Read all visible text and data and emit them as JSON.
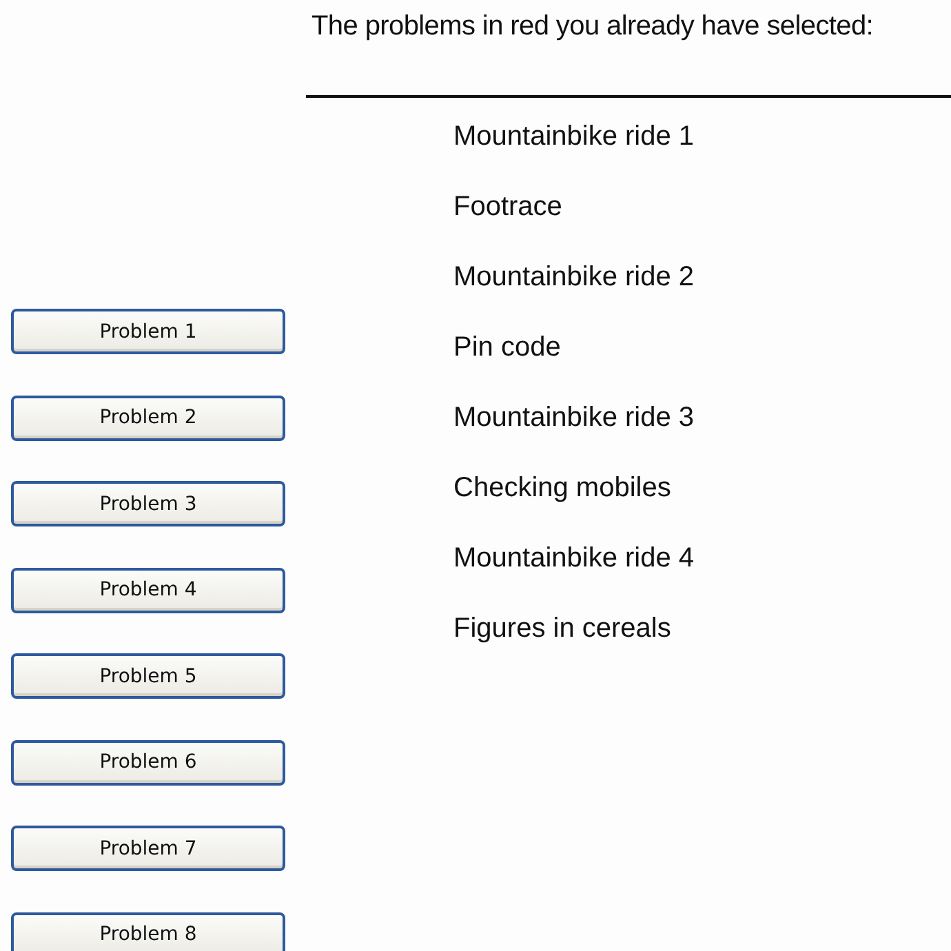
{
  "heading": "The problems in red you already have selected:",
  "buttons": [
    "Problem 1",
    "Problem 2",
    "Problem 3",
    "Problem 4",
    "Problem 5",
    "Problem 6",
    "Problem 7",
    "Problem 8"
  ],
  "problems": [
    "Mountainbike ride 1",
    "Footrace",
    "Mountainbike ride 2",
    "Pin code",
    "Mountainbike ride 3",
    "Checking mobiles",
    "Mountainbike ride 4",
    "Figures in cereals"
  ]
}
